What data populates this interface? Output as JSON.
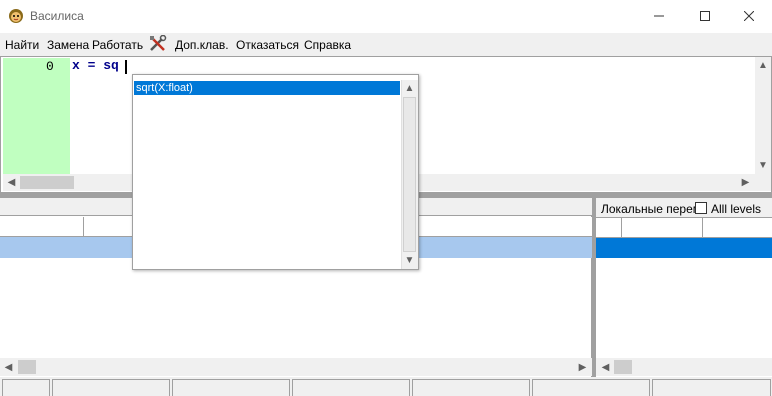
{
  "window": {
    "title": "Василиса",
    "icons": {
      "app": "gnome-face-icon",
      "minimize": "minimize-icon",
      "maximize": "maximize-icon",
      "close": "close-icon"
    }
  },
  "menu": {
    "find": "Найти",
    "replace": "Замена",
    "run": "Работать",
    "tools_icon": "tools-icon",
    "extra_keys": "Доп.клав.",
    "cancel": "Отказаться",
    "help": "Справка"
  },
  "editor": {
    "line_number": "0",
    "code": "x = sq"
  },
  "autocomplete": {
    "items": [
      "sqrt(X:float)"
    ]
  },
  "right_panel": {
    "label": "Локальные переменные",
    "checkbox_label": "Alll levels",
    "checkbox_checked": false
  },
  "colors": {
    "gutter": "#c0ffc0",
    "code": "#00008b",
    "selection": "#0078d7",
    "row_highlight": "#a7c8ee"
  }
}
